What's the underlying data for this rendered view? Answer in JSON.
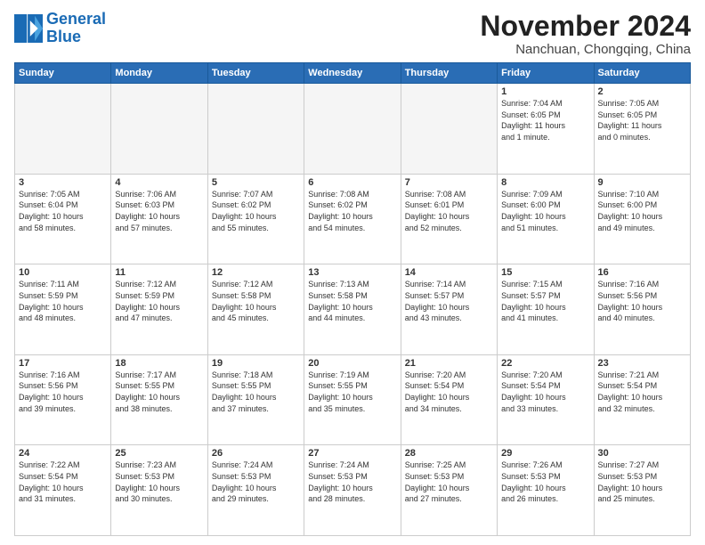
{
  "logo": {
    "line1": "General",
    "line2": "Blue"
  },
  "title": "November 2024",
  "subtitle": "Nanchuan, Chongqing, China",
  "weekdays": [
    "Sunday",
    "Monday",
    "Tuesday",
    "Wednesday",
    "Thursday",
    "Friday",
    "Saturday"
  ],
  "weeks": [
    [
      {
        "day": "",
        "info": ""
      },
      {
        "day": "",
        "info": ""
      },
      {
        "day": "",
        "info": ""
      },
      {
        "day": "",
        "info": ""
      },
      {
        "day": "",
        "info": ""
      },
      {
        "day": "1",
        "info": "Sunrise: 7:04 AM\nSunset: 6:05 PM\nDaylight: 11 hours\nand 1 minute."
      },
      {
        "day": "2",
        "info": "Sunrise: 7:05 AM\nSunset: 6:05 PM\nDaylight: 11 hours\nand 0 minutes."
      }
    ],
    [
      {
        "day": "3",
        "info": "Sunrise: 7:05 AM\nSunset: 6:04 PM\nDaylight: 10 hours\nand 58 minutes."
      },
      {
        "day": "4",
        "info": "Sunrise: 7:06 AM\nSunset: 6:03 PM\nDaylight: 10 hours\nand 57 minutes."
      },
      {
        "day": "5",
        "info": "Sunrise: 7:07 AM\nSunset: 6:02 PM\nDaylight: 10 hours\nand 55 minutes."
      },
      {
        "day": "6",
        "info": "Sunrise: 7:08 AM\nSunset: 6:02 PM\nDaylight: 10 hours\nand 54 minutes."
      },
      {
        "day": "7",
        "info": "Sunrise: 7:08 AM\nSunset: 6:01 PM\nDaylight: 10 hours\nand 52 minutes."
      },
      {
        "day": "8",
        "info": "Sunrise: 7:09 AM\nSunset: 6:00 PM\nDaylight: 10 hours\nand 51 minutes."
      },
      {
        "day": "9",
        "info": "Sunrise: 7:10 AM\nSunset: 6:00 PM\nDaylight: 10 hours\nand 49 minutes."
      }
    ],
    [
      {
        "day": "10",
        "info": "Sunrise: 7:11 AM\nSunset: 5:59 PM\nDaylight: 10 hours\nand 48 minutes."
      },
      {
        "day": "11",
        "info": "Sunrise: 7:12 AM\nSunset: 5:59 PM\nDaylight: 10 hours\nand 47 minutes."
      },
      {
        "day": "12",
        "info": "Sunrise: 7:12 AM\nSunset: 5:58 PM\nDaylight: 10 hours\nand 45 minutes."
      },
      {
        "day": "13",
        "info": "Sunrise: 7:13 AM\nSunset: 5:58 PM\nDaylight: 10 hours\nand 44 minutes."
      },
      {
        "day": "14",
        "info": "Sunrise: 7:14 AM\nSunset: 5:57 PM\nDaylight: 10 hours\nand 43 minutes."
      },
      {
        "day": "15",
        "info": "Sunrise: 7:15 AM\nSunset: 5:57 PM\nDaylight: 10 hours\nand 41 minutes."
      },
      {
        "day": "16",
        "info": "Sunrise: 7:16 AM\nSunset: 5:56 PM\nDaylight: 10 hours\nand 40 minutes."
      }
    ],
    [
      {
        "day": "17",
        "info": "Sunrise: 7:16 AM\nSunset: 5:56 PM\nDaylight: 10 hours\nand 39 minutes."
      },
      {
        "day": "18",
        "info": "Sunrise: 7:17 AM\nSunset: 5:55 PM\nDaylight: 10 hours\nand 38 minutes."
      },
      {
        "day": "19",
        "info": "Sunrise: 7:18 AM\nSunset: 5:55 PM\nDaylight: 10 hours\nand 37 minutes."
      },
      {
        "day": "20",
        "info": "Sunrise: 7:19 AM\nSunset: 5:55 PM\nDaylight: 10 hours\nand 35 minutes."
      },
      {
        "day": "21",
        "info": "Sunrise: 7:20 AM\nSunset: 5:54 PM\nDaylight: 10 hours\nand 34 minutes."
      },
      {
        "day": "22",
        "info": "Sunrise: 7:20 AM\nSunset: 5:54 PM\nDaylight: 10 hours\nand 33 minutes."
      },
      {
        "day": "23",
        "info": "Sunrise: 7:21 AM\nSunset: 5:54 PM\nDaylight: 10 hours\nand 32 minutes."
      }
    ],
    [
      {
        "day": "24",
        "info": "Sunrise: 7:22 AM\nSunset: 5:54 PM\nDaylight: 10 hours\nand 31 minutes."
      },
      {
        "day": "25",
        "info": "Sunrise: 7:23 AM\nSunset: 5:53 PM\nDaylight: 10 hours\nand 30 minutes."
      },
      {
        "day": "26",
        "info": "Sunrise: 7:24 AM\nSunset: 5:53 PM\nDaylight: 10 hours\nand 29 minutes."
      },
      {
        "day": "27",
        "info": "Sunrise: 7:24 AM\nSunset: 5:53 PM\nDaylight: 10 hours\nand 28 minutes."
      },
      {
        "day": "28",
        "info": "Sunrise: 7:25 AM\nSunset: 5:53 PM\nDaylight: 10 hours\nand 27 minutes."
      },
      {
        "day": "29",
        "info": "Sunrise: 7:26 AM\nSunset: 5:53 PM\nDaylight: 10 hours\nand 26 minutes."
      },
      {
        "day": "30",
        "info": "Sunrise: 7:27 AM\nSunset: 5:53 PM\nDaylight: 10 hours\nand 25 minutes."
      }
    ]
  ]
}
